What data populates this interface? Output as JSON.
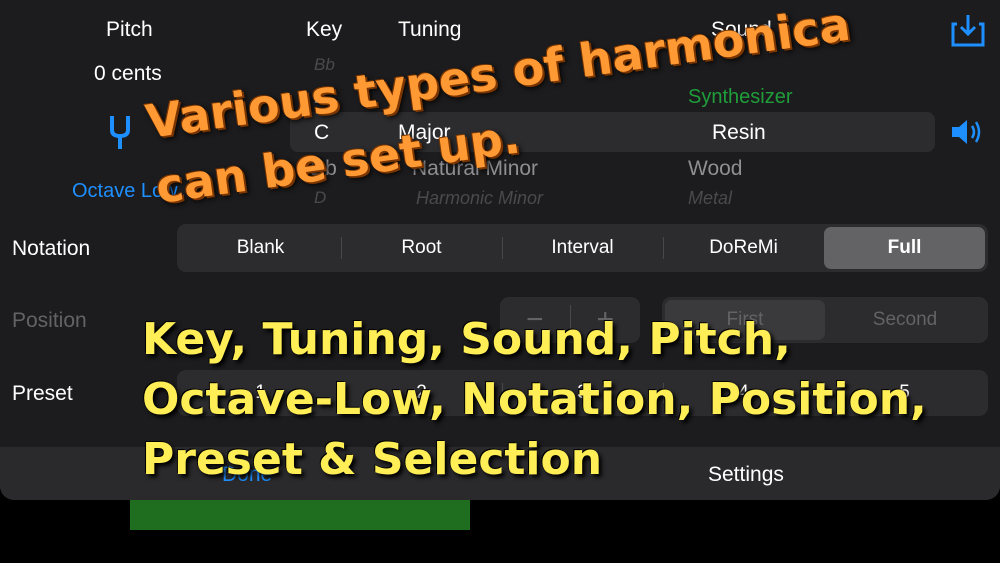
{
  "header": {
    "pitch_label": "Pitch",
    "key_label": "Key",
    "tuning_label": "Tuning",
    "sound_label": "Sound",
    "download_icon": "download-icon"
  },
  "pitch": {
    "value": "0 cents",
    "fork_icon": "tuning-fork-icon",
    "octave_label": "Octave Low"
  },
  "picker": {
    "keys": [
      "Bb",
      "B",
      "C",
      "Db",
      "D"
    ],
    "selected_key": "C",
    "tunings": [
      "Major",
      "Natural Minor",
      "Harmonic Minor"
    ],
    "selected_tuning": "Major",
    "sounds": [
      "Synthesizer",
      "Resin",
      "Wood",
      "Metal"
    ],
    "selected_sound": "Resin",
    "speaker_icon": "speaker-icon"
  },
  "notation": {
    "label": "Notation",
    "options": [
      "Blank",
      "Root",
      "Interval",
      "DoReMi",
      "Full"
    ],
    "selected": "Full"
  },
  "position": {
    "label": "Position",
    "minus": "−",
    "plus": "+",
    "options": [
      "First",
      "Second"
    ],
    "selected": "First"
  },
  "preset": {
    "label": "Preset",
    "options": [
      "1",
      "2",
      "3",
      "4",
      "5"
    ]
  },
  "footer": {
    "done_label": "Done",
    "settings_label": "Settings"
  },
  "overlay": {
    "title_line1": "Various types of harmonica",
    "title_line2": "can be set up.",
    "features_line1": "Key, Tuning, Sound, Pitch,",
    "features_line2": "Octave-Low, Notation, Position,",
    "features_line3": "Preset & Selection"
  },
  "colors": {
    "accent": "#1e8fff",
    "panel": "#1c1c1e",
    "overlay_orange": "#ff9933",
    "overlay_yellow": "#ffee55"
  }
}
